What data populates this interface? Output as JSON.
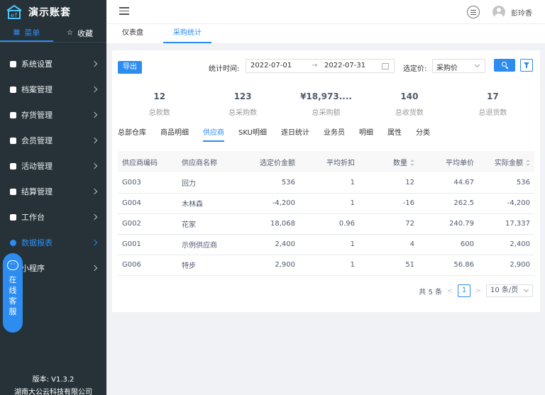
{
  "app": {
    "title": "演示账套"
  },
  "sidebar": {
    "tabs": [
      {
        "label": "菜单",
        "icon": "grid-icon",
        "active": true
      },
      {
        "label": "收藏",
        "icon": "star-icon",
        "active": false
      }
    ],
    "items": [
      {
        "label": "系统设置"
      },
      {
        "label": "档案管理"
      },
      {
        "label": "存货管理"
      },
      {
        "label": "会员管理"
      },
      {
        "label": "活动管理"
      },
      {
        "label": "结算管理"
      },
      {
        "label": "工作台"
      },
      {
        "label": "数据报表",
        "active": true
      },
      {
        "label": "小程序"
      }
    ],
    "footer": {
      "version": "版本: V1.3.2",
      "company": "湖南大公云科技有限公司"
    }
  },
  "float_service": {
    "text": [
      "在",
      "线",
      "客",
      "服"
    ]
  },
  "header": {
    "username": "彭玲香"
  },
  "page_tabs": [
    {
      "label": "仪表盘",
      "active": false
    },
    {
      "label": "采购统计",
      "active": true
    }
  ],
  "toolbar": {
    "export_label": "导出",
    "date_label": "统计时间:",
    "start_date": "2022-07-01",
    "end_date": "2022-07-31",
    "arrow": "→",
    "price_label": "选定价:",
    "price_value": "采购价"
  },
  "stats": [
    {
      "value": "12",
      "label": "总款数"
    },
    {
      "value": "123",
      "label": "总采购数"
    },
    {
      "value": "¥18,973....",
      "label": "总采购额"
    },
    {
      "value": "140",
      "label": "总收货数"
    },
    {
      "value": "17",
      "label": "总退货数"
    }
  ],
  "sub_tabs": [
    {
      "label": "总部仓库"
    },
    {
      "label": "商品明细"
    },
    {
      "label": "供应商",
      "active": true
    },
    {
      "label": "SKU明细"
    },
    {
      "label": "逐日统计"
    },
    {
      "label": "业务员"
    },
    {
      "label": "明细"
    },
    {
      "label": "属性"
    },
    {
      "label": "分类"
    }
  ],
  "table": {
    "columns": [
      "供应商编码",
      "供应商名称",
      "选定价金额",
      "平均折扣",
      "数量",
      "平均单价",
      "实际金额"
    ],
    "rows": [
      [
        "G003",
        "回力",
        "536",
        "1",
        "12",
        "44.67",
        "536"
      ],
      [
        "G004",
        "木林森",
        "-4,200",
        "1",
        "-16",
        "262.5",
        "-4,200"
      ],
      [
        "G002",
        "花家",
        "18,068",
        "0.96",
        "72",
        "240.79",
        "17,337"
      ],
      [
        "G001",
        "示例供应商",
        "2,400",
        "1",
        "4",
        "600",
        "2,400"
      ],
      [
        "G006",
        "特步",
        "2,900",
        "1",
        "51",
        "56.86",
        "2,900"
      ]
    ]
  },
  "pagination": {
    "total_text": "共 5 条",
    "prev": "<",
    "current": "1",
    "next": ">",
    "page_size": "10 条/页"
  }
}
